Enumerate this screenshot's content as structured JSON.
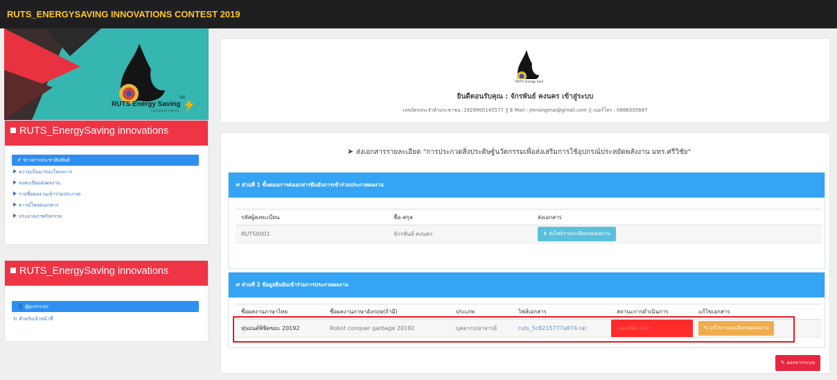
{
  "app_title": "RUTS_ENERGYSAVING INNOVATIONS CONTEST 2019",
  "sidebar": {
    "banner": {
      "logo_text": "RUTS Energy Saving",
      "logo_sub": "1st",
      "logo_tagline": "Innovations Contest"
    },
    "panel1": {
      "title": "RUTS_EnergySaving innovations",
      "active_button": "ข่าวสารประชาสัมพันธ์",
      "links": [
        "ความเป็นมาของโครงการ",
        "ลงทะเบียนส่งผลงาน",
        "รายชื่อผลงานเข้าร่วมประกวด",
        "ดาวน์โหลดเอกสาร",
        "ประมวลภาพกิจกรรม"
      ]
    },
    "panel2": {
      "title": "RUTS_EnergySaving innovations",
      "active_button": "ผู้ดูแลระบบ",
      "link": "สำหรับเจ้าหน้าที่"
    }
  },
  "welcome": {
    "greeting": "ยินดีตอนรับคุณ : จักรพันธ์ คงนคร เข้าสู่ระบบ",
    "details": "เลขบัตรประจำตัวประชาชน :1929900145577 || E-Mail : jmnongmai@gmail.com || เบอร์โทร : 0888305687"
  },
  "submit_heading": "ส่งเอกสารรายละเอียด   \"การประกวดสิ่งประดิษฐ์นวัตกรรมเพื่อส่งเสริมการใช้อุปกรณ์ประหยัดพลังงาน  มทร.ศรีวิชัย\"",
  "section1": {
    "title": "ส่วนที่  1   ขั้นตอนการส่งเอกสารยืนยันการเข้าร่วมประกวดผลงาน",
    "headers": [
      "รหัสผู้ลงทะเบียน",
      "ชื่อ-สกุล",
      "ส่งเอกสาร"
    ],
    "row": {
      "id": "RUTS0001",
      "name": "จักรพันธ์ คงนคร",
      "button": "ส่งไฟล์รายละเอียดของผลงาน"
    }
  },
  "section2": {
    "title": "ส่วนที่  2   ข้อมูลยืนยันเข้าร่วมการประกวดผลงาน",
    "headers": [
      "ชื่อผลงานภาษาไทย",
      "ชื่อผลงานภาษาอังกฤษ(ถ้ามี)",
      "ประเภท",
      "ไฟล์เอกสาร",
      "สถานะการดำเนินการ",
      "แก้ไขเอกสาร"
    ],
    "row": {
      "thai_name": "หุ่นยนต์พิชิตขยะ 20192",
      "eng_name": "Robot conquer garbage 20192",
      "type": "บุคลากร/อาจารย์",
      "file": "ruts_5c8215777a874.rar",
      "status": "รอผลพิจารณา",
      "button": "แก้ไขรายละเอียดของผลงาน"
    }
  },
  "logout_label": "ออกจากระบบ",
  "colors": {
    "topbar": "#1f1f22",
    "title": "#ffc62a",
    "teal": "#36b6b0",
    "red": "#ef3446",
    "blue": "#35a4f4"
  }
}
